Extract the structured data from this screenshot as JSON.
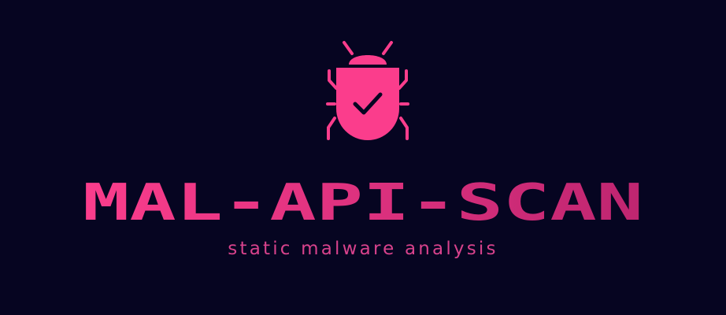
{
  "brand": {
    "title": "MAL-API-SCAN",
    "tagline": "static malware analysis",
    "icon": "bug-check-icon",
    "colors": {
      "background": "#060521",
      "accent": "#fb3d8c",
      "accent_dark": "#be2570",
      "tagline": "#d8428c",
      "check": "#060521"
    }
  }
}
